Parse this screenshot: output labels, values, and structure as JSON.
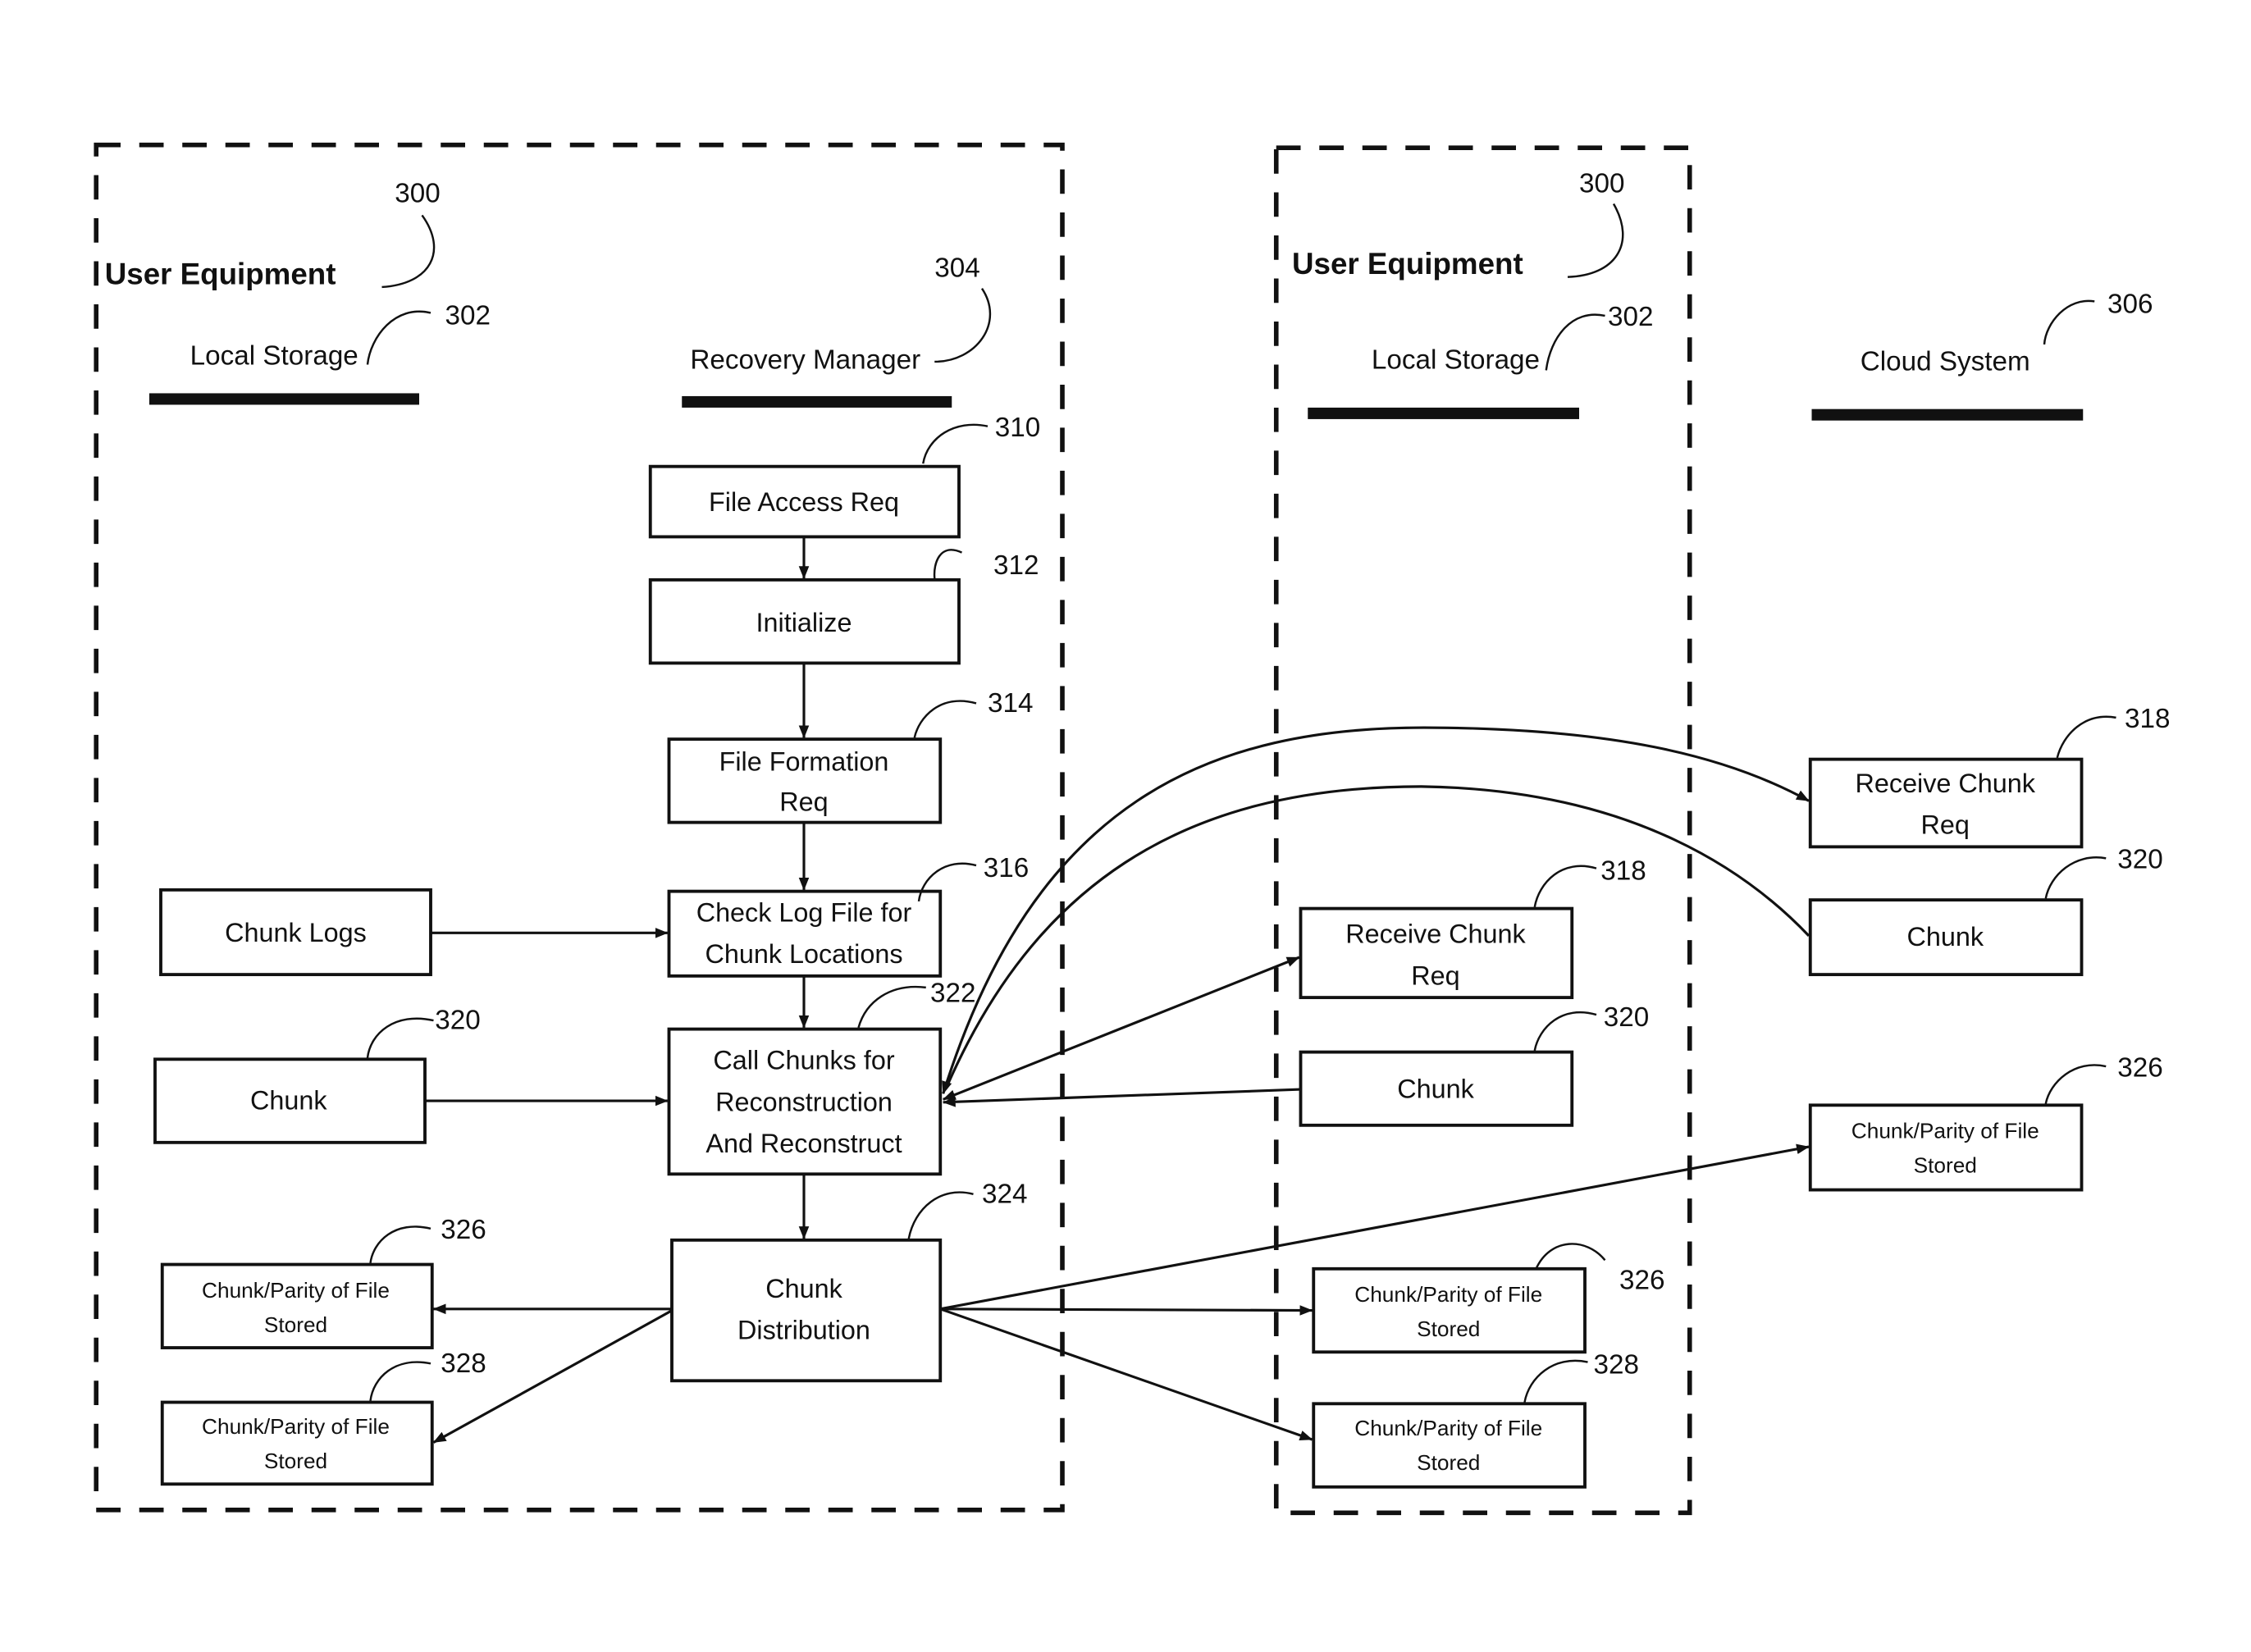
{
  "figure": {
    "regions": [
      {
        "id": "ue-left",
        "title": "User Equipment",
        "ref": "300"
      },
      {
        "id": "ue-right",
        "title": "User Equipment",
        "ref": "300"
      }
    ],
    "lanes": [
      {
        "id": "local-storage-left",
        "label": "Local Storage",
        "ref": "302"
      },
      {
        "id": "recovery-manager",
        "label": "Recovery Manager",
        "ref": "304"
      },
      {
        "id": "local-storage-right",
        "label": "Local Storage",
        "ref": "302"
      },
      {
        "id": "cloud-system",
        "label": "Cloud System",
        "ref": "306"
      }
    ],
    "nodes": {
      "file_access_req": {
        "lines": [
          "File Access Req"
        ],
        "ref": "310"
      },
      "initialize": {
        "lines": [
          "Initialize"
        ],
        "ref": "312"
      },
      "file_formation_req": {
        "lines": [
          "File Formation",
          "Req"
        ],
        "ref": "314"
      },
      "check_log_file": {
        "lines": [
          "Check Log File for",
          "Chunk Locations"
        ],
        "ref": "316"
      },
      "call_chunks": {
        "lines": [
          "Call Chunks for",
          "Reconstruction",
          "And Reconstruct"
        ],
        "ref": "322"
      },
      "chunk_distribution": {
        "lines": [
          "Chunk",
          "Distribution"
        ],
        "ref": "324"
      },
      "chunk_logs": {
        "lines": [
          "Chunk Logs"
        ]
      },
      "chunk_left": {
        "lines": [
          "Chunk"
        ],
        "ref": "320"
      },
      "stored_left_326": {
        "lines": [
          "Chunk/Parity of File",
          "Stored"
        ],
        "ref": "326"
      },
      "stored_left_328": {
        "lines": [
          "Chunk/Parity of File",
          "Stored"
        ],
        "ref": "328"
      },
      "receive_req_right": {
        "lines": [
          "Receive Chunk",
          "Req"
        ],
        "ref": "318"
      },
      "chunk_right": {
        "lines": [
          "Chunk"
        ],
        "ref": "320"
      },
      "stored_right_326": {
        "lines": [
          "Chunk/Parity of File",
          "Stored"
        ],
        "ref": "326"
      },
      "stored_right_328": {
        "lines": [
          "Chunk/Parity of File",
          "Stored"
        ],
        "ref": "328"
      },
      "receive_req_cloud": {
        "lines": [
          "Receive Chunk",
          "Req"
        ],
        "ref": "318"
      },
      "chunk_cloud": {
        "lines": [
          "Chunk"
        ],
        "ref": "320"
      },
      "stored_cloud_326": {
        "lines": [
          "Chunk/Parity of File",
          "Stored"
        ],
        "ref": "326"
      }
    },
    "edges": [
      {
        "from": "file_access_req",
        "to": "initialize"
      },
      {
        "from": "initialize",
        "to": "file_formation_req"
      },
      {
        "from": "file_formation_req",
        "to": "check_log_file"
      },
      {
        "from": "chunk_logs",
        "to": "check_log_file"
      },
      {
        "from": "check_log_file",
        "to": "call_chunks"
      },
      {
        "from": "chunk_left",
        "to": "call_chunks"
      },
      {
        "from": "call_chunks",
        "to": "receive_req_right"
      },
      {
        "from": "chunk_right",
        "to": "call_chunks"
      },
      {
        "from": "call_chunks",
        "to": "receive_req_cloud"
      },
      {
        "from": "chunk_cloud",
        "to": "call_chunks"
      },
      {
        "from": "call_chunks",
        "to": "chunk_distribution"
      },
      {
        "from": "chunk_distribution",
        "to": "stored_left_326"
      },
      {
        "from": "chunk_distribution",
        "to": "stored_left_328"
      },
      {
        "from": "chunk_distribution",
        "to": "stored_right_326"
      },
      {
        "from": "chunk_distribution",
        "to": "stored_right_328"
      },
      {
        "from": "chunk_distribution",
        "to": "stored_cloud_326"
      }
    ]
  }
}
